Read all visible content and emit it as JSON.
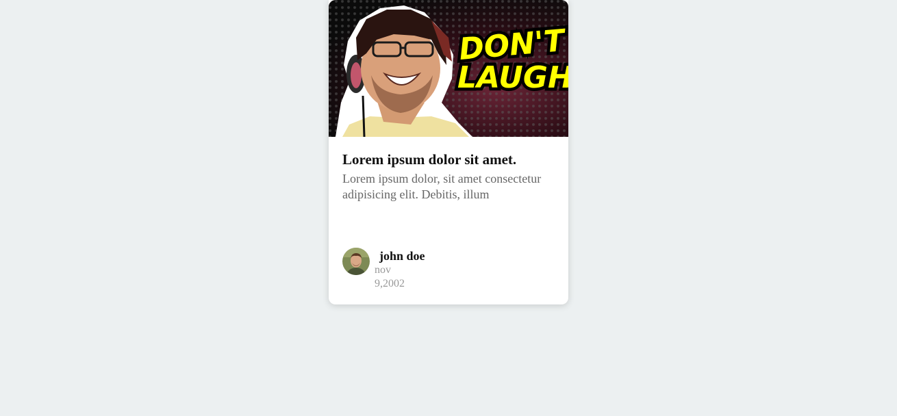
{
  "card": {
    "image": {
      "overlay_text_line1": "DON'T",
      "overlay_text_line2": "LAUGH",
      "overlay_text_color": "#ffff00"
    },
    "title": "Lorem ipsum dolor sit amet.",
    "text": "Lorem ipsum dolor, sit amet consectetur adipisicing elit. Debitis, illum",
    "user": {
      "name": "john doe",
      "date": "nov 9,2002"
    }
  },
  "colors": {
    "background": "#ecf0f1",
    "card": "#ffffff",
    "title": "#111111",
    "text": "#666666",
    "date": "#999999"
  }
}
